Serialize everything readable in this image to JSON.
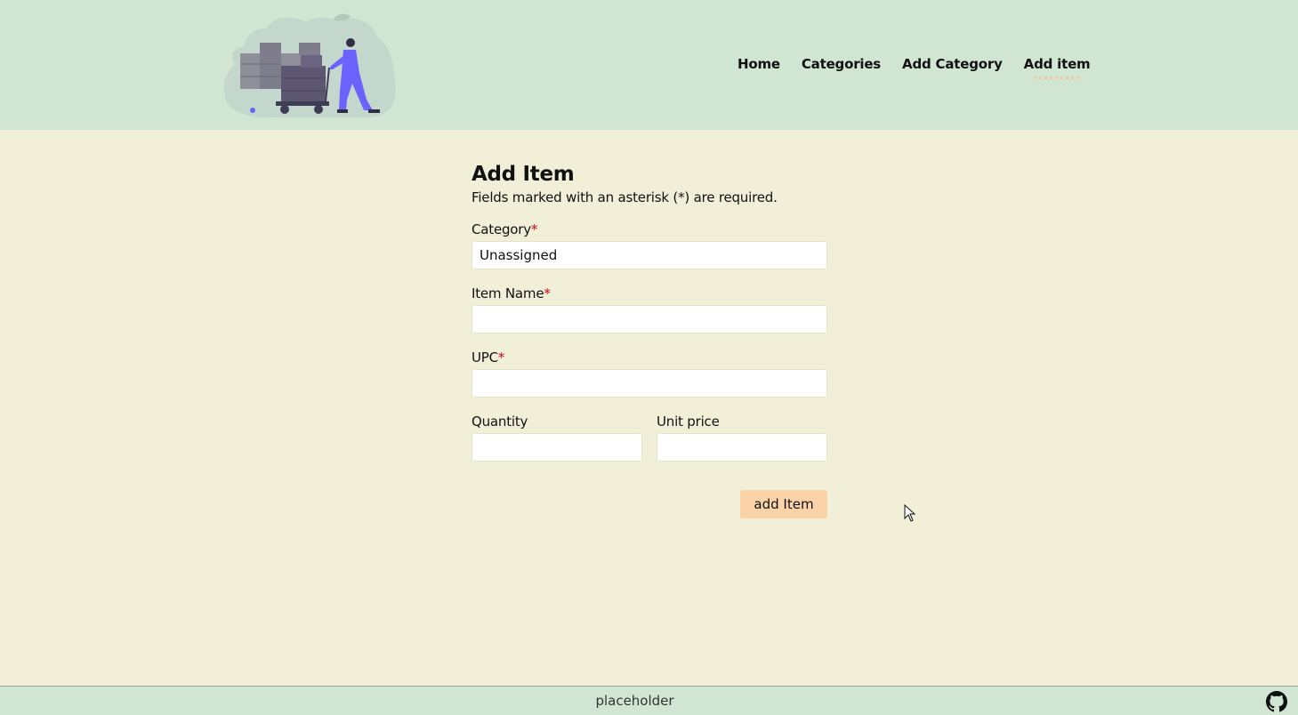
{
  "nav": {
    "items": [
      {
        "label": "Home"
      },
      {
        "label": "Categories"
      },
      {
        "label": "Add Category"
      },
      {
        "label": "Add item"
      }
    ]
  },
  "form": {
    "title": "Add Item",
    "note": "Fields marked with an asterisk (*) are required.",
    "required_marker": "*",
    "category": {
      "label": "Category",
      "value": "Unassigned"
    },
    "item_name": {
      "label": "Item Name",
      "value": ""
    },
    "upc": {
      "label": "UPC",
      "value": ""
    },
    "quantity": {
      "label": "Quantity",
      "value": ""
    },
    "unit_price": {
      "label": "Unit price",
      "value": ""
    },
    "submit_label": "add Item"
  },
  "footer": {
    "text": "placeholder"
  },
  "colors": {
    "header_bg": "#d0e6d3",
    "page_bg": "#f1efd7",
    "button_bg": "#fcd3a8",
    "required": "#d0021b",
    "illustration_accent": "#6c63ff"
  },
  "icons": [
    "warehouse-illustration",
    "github-icon",
    "mouse-cursor-icon"
  ]
}
